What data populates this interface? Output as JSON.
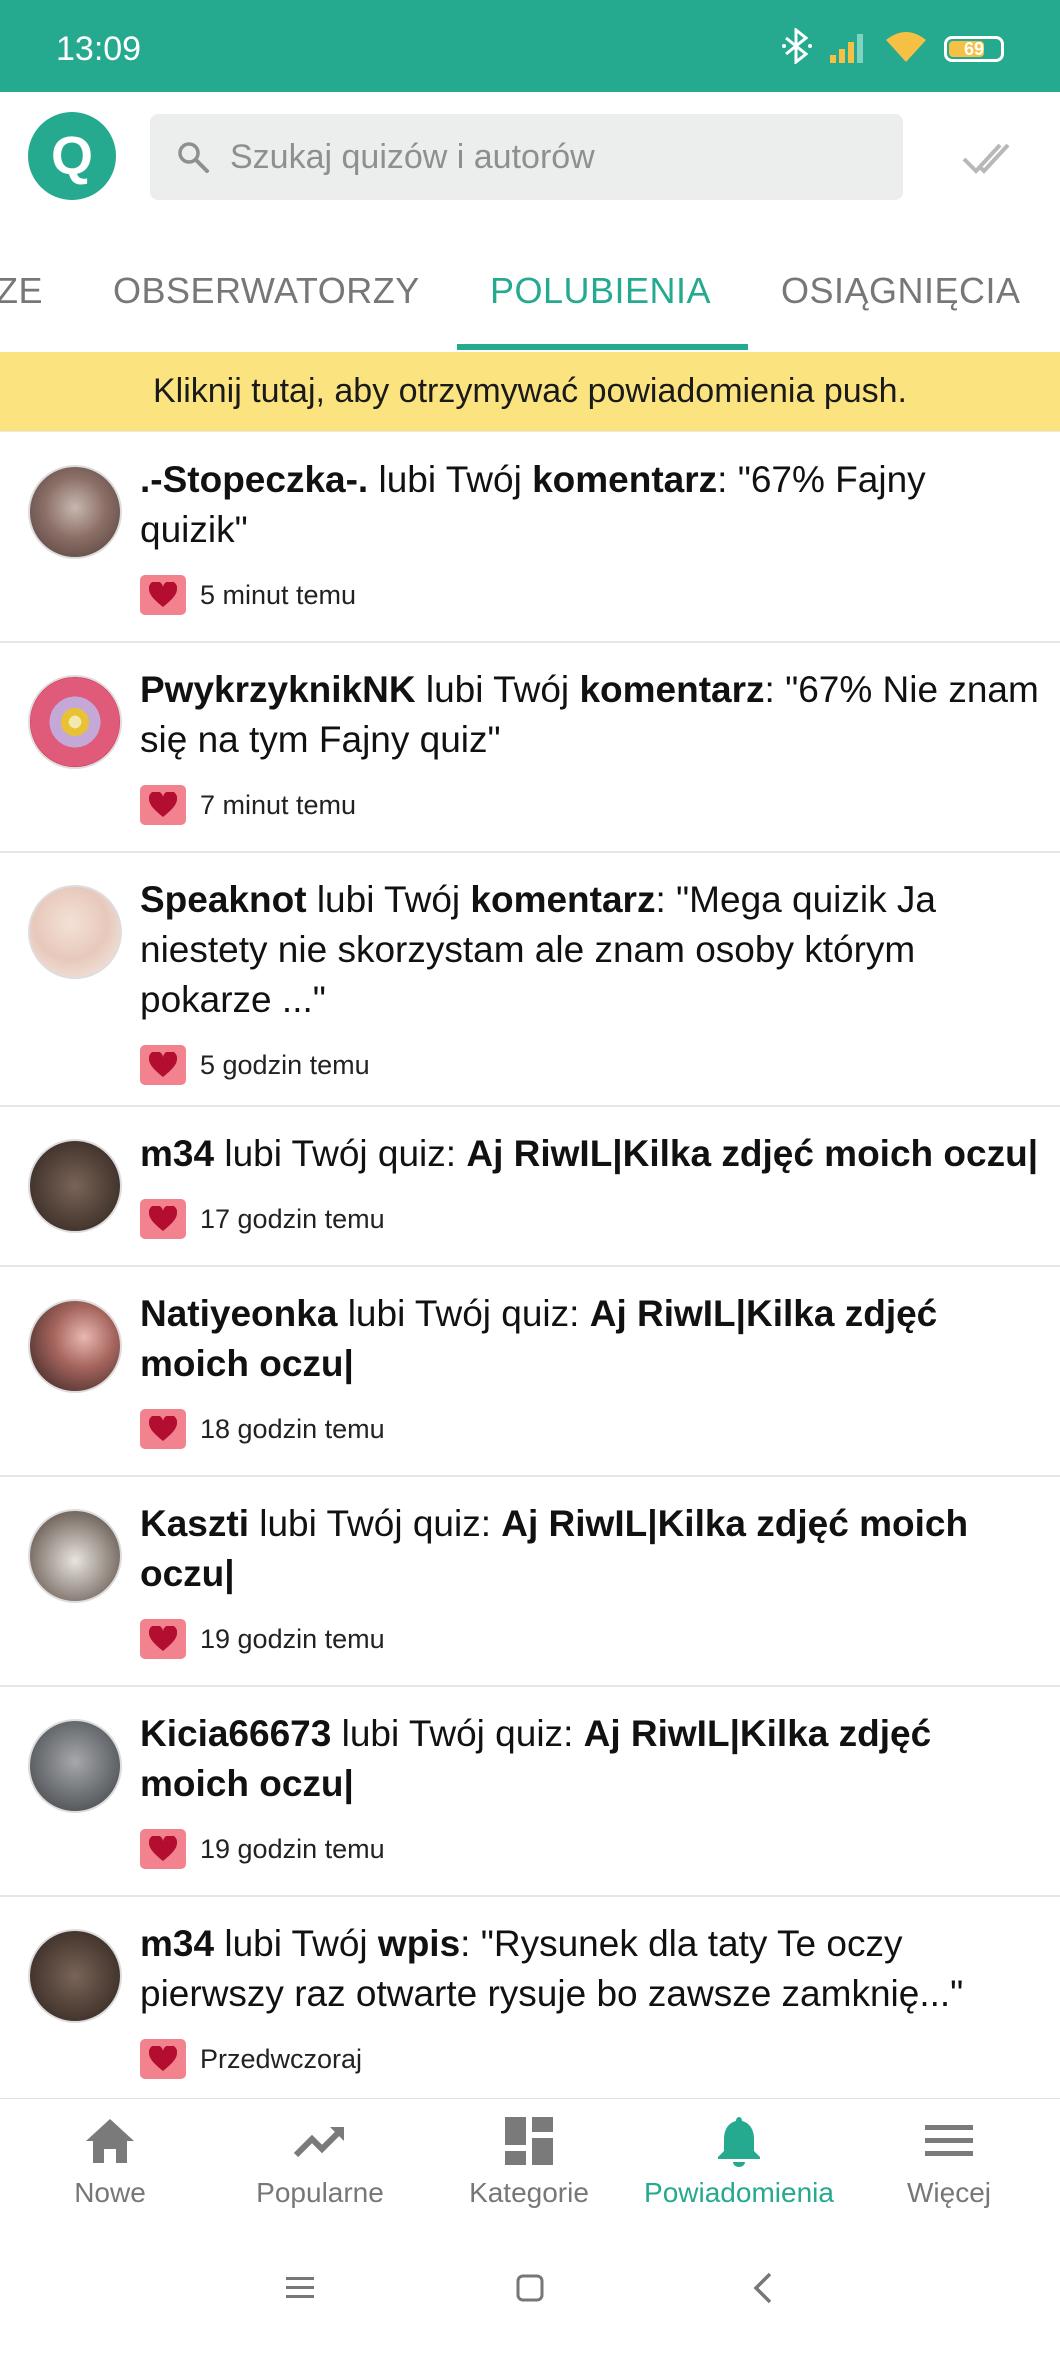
{
  "status_bar": {
    "time": "13:09",
    "battery": "69",
    "battery_level": 0.69,
    "icons": [
      "bluetooth-icon",
      "signal-icon",
      "wifi-icon",
      "battery-icon"
    ]
  },
  "header": {
    "logo_letter": "Q",
    "search_placeholder": "Szukaj quizów i autorów"
  },
  "tabs": [
    {
      "label": "ZE",
      "active": false
    },
    {
      "label": "OBSERWATORZY",
      "active": false
    },
    {
      "label": "POLUBIENIA",
      "active": true
    },
    {
      "label": "OSIĄGNIĘCIA",
      "active": false
    }
  ],
  "banner": {
    "text": "Kliknij tutaj, aby otrzymywać powiadomienia push."
  },
  "notifications": [
    {
      "user": ".-Stopeczka-.",
      "verb": " lubi Twój ",
      "object": "komentarz",
      "sep": ": ",
      "content": "\"67% Fajny quizik\"",
      "content_bold": false,
      "time": "5 minut temu"
    },
    {
      "user": "PwykrzyknikNK",
      "verb": " lubi Twój ",
      "object": "komentarz",
      "sep": ": ",
      "content": "\"67% Nie znam się na tym Fajny quiz\"",
      "content_bold": false,
      "time": "7 minut temu"
    },
    {
      "user": "Speaknot",
      "verb": " lubi Twój ",
      "object": "komentarz",
      "sep": ": ",
      "content": "\"Mega quizik Ja niestety nie skorzystam ale znam osoby którym pokarze ...\"",
      "content_bold": false,
      "time": "5 godzin temu"
    },
    {
      "user": "m34",
      "verb": " lubi Twój quiz",
      "object": "",
      "sep": ": ",
      "content": "Aj RiwIL|Kilka zdjęć moich oczu|",
      "content_bold": true,
      "time": "17 godzin temu"
    },
    {
      "user": "Natiyeonka",
      "verb": " lubi Twój quiz",
      "object": "",
      "sep": ": ",
      "content": "Aj RiwIL|Kilka zdjęć moich oczu|",
      "content_bold": true,
      "time": "18 godzin temu"
    },
    {
      "user": "Kaszti",
      "verb": " lubi Twój quiz",
      "object": "",
      "sep": ": ",
      "content": "Aj RiwIL|Kilka zdjęć moich oczu|",
      "content_bold": true,
      "time": "19 godzin temu"
    },
    {
      "user": "Kicia66673",
      "verb": " lubi Twój quiz",
      "object": "",
      "sep": ": ",
      "content": "Aj RiwIL|Kilka zdjęć moich oczu|",
      "content_bold": true,
      "time": "19 godzin temu"
    },
    {
      "user": "m34",
      "verb": " lubi Twój ",
      "object": "wpis",
      "sep": ": ",
      "content": "\"Rysunek dla taty Te oczy pierwszy raz otwarte rysuje bo zawsze zamknię...\"",
      "content_bold": false,
      "time": "Przedwczoraj"
    }
  ],
  "bottom_nav": [
    {
      "label": "Nowe",
      "icon": "home-icon",
      "active": false
    },
    {
      "label": "Popularne",
      "icon": "trending-icon",
      "active": false
    },
    {
      "label": "Kategorie",
      "icon": "grid-icon",
      "active": false
    },
    {
      "label": "Powiadomienia",
      "icon": "bell-icon",
      "active": true
    },
    {
      "label": "Więcej",
      "icon": "menu-icon",
      "active": false
    }
  ],
  "colors": {
    "accent": "#25a98f",
    "banner": "#fbe480",
    "heart_badge": "#f3828f",
    "inactive": "#777777"
  }
}
